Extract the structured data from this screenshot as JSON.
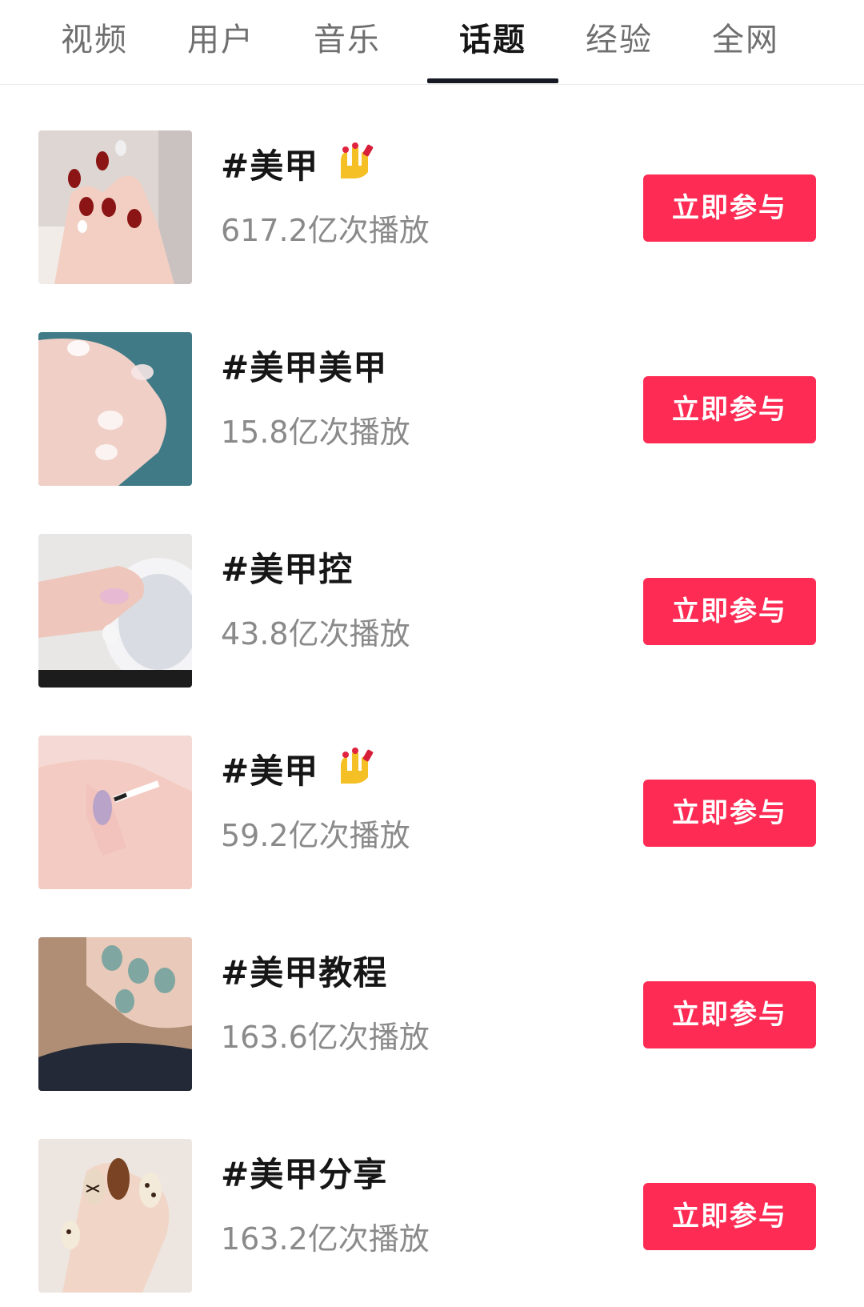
{
  "tabs": [
    {
      "label": "视频",
      "active": false
    },
    {
      "label": "用户",
      "active": false
    },
    {
      "label": "音乐",
      "active": false
    },
    {
      "label": "话题",
      "active": true
    },
    {
      "label": "经验",
      "active": false
    },
    {
      "label": "全网",
      "active": false
    }
  ],
  "colors": {
    "accent": "#fe2c55",
    "active_tab_text": "#161616",
    "inactive_tab_text": "#6f6f6f",
    "topic_text": "#161616",
    "plays_text": "#8a8a8a"
  },
  "topics": [
    {
      "title": "#美甲",
      "emoji": "nail-polish-icon",
      "plays": "617.2亿次播放",
      "button": "立即参与",
      "thumbnail": "nail-photo-dark-red"
    },
    {
      "title": "#美甲美甲",
      "plays": "15.8亿次播放",
      "button": "立即参与",
      "thumbnail": "nail-photo-clear-teal-bg"
    },
    {
      "title": "#美甲控",
      "plays": "43.8亿次播放",
      "button": "立即参与",
      "thumbnail": "nail-photo-glitter-bowl"
    },
    {
      "title": "#美甲",
      "emoji": "nail-polish-icon",
      "plays": "59.2亿次播放",
      "button": "立即参与",
      "thumbnail": "nail-photo-purple-brush"
    },
    {
      "title": "#美甲教程",
      "plays": "163.6亿次播放",
      "button": "立即参与",
      "thumbnail": "nail-photo-sage-green"
    },
    {
      "title": "#美甲分享",
      "plays": "163.2亿次播放",
      "button": "立即参与",
      "thumbnail": "nail-photo-brown-leopard"
    }
  ]
}
